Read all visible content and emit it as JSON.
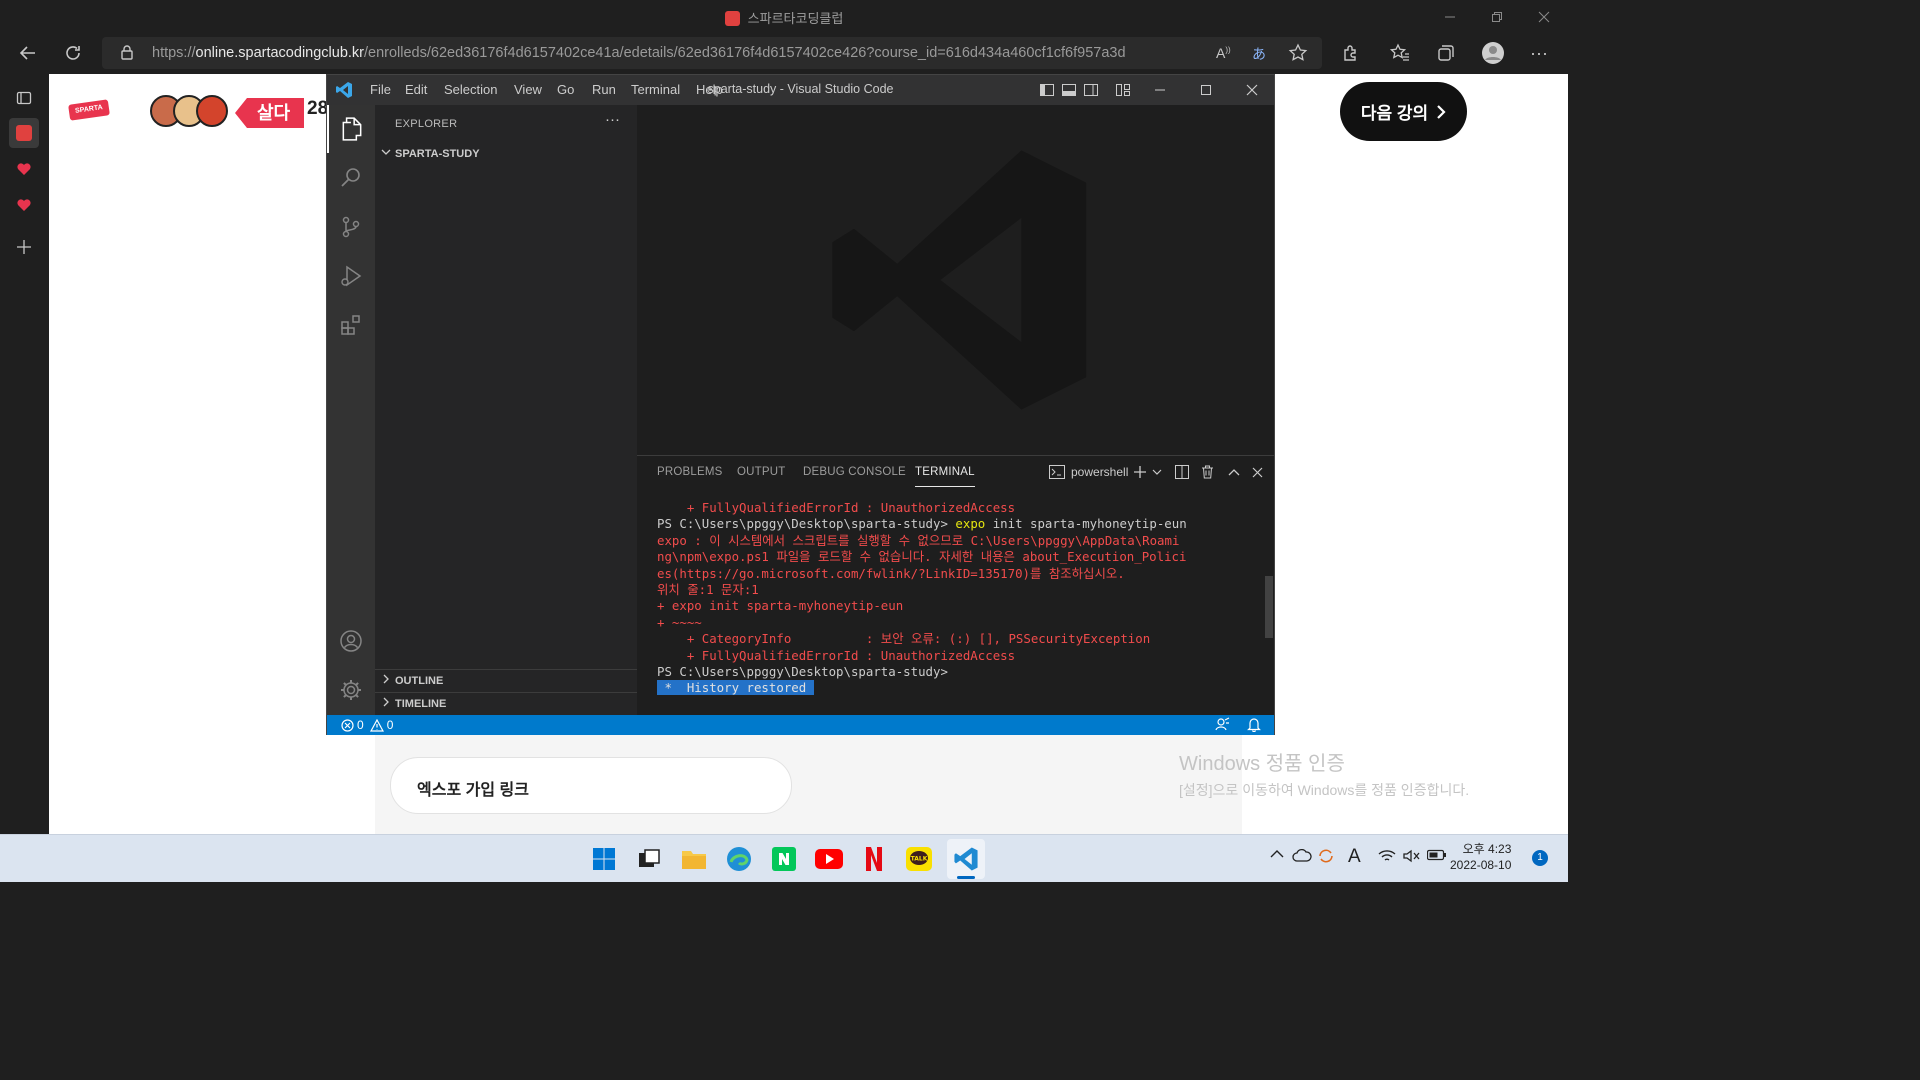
{
  "browser": {
    "tab_title": "스파르타코딩클럽",
    "url_prefix": "https://",
    "url_domain": "online.spartacodingclub.kr",
    "url_path": "/enrolleds/62ed36176f4d6157402ce41a/edetails/62ed36176f4d6157402ce426?course_id=616d434a460cf1cf6f957a3d"
  },
  "webpage": {
    "logo_text": "SPARTA",
    "live_badge": "살다",
    "live_count": "28",
    "next_lesson_label": "다음 강의",
    "expo_link_label": "엑스포 가입 링크",
    "windows_activate_title": "Windows 정품 인증",
    "windows_activate_desc": "[설정]으로 이동하여 Windows를 정품 인증합니다."
  },
  "vscode": {
    "menu": [
      "File",
      "Edit",
      "Selection",
      "View",
      "Go",
      "Run",
      "Terminal",
      "Help"
    ],
    "window_title": "sparta-study - Visual Studio Code",
    "explorer_header": "EXPLORER",
    "explorer_more": "···",
    "folder_name": "SPARTA-STUDY",
    "outline_label": "OUTLINE",
    "timeline_label": "TIMELINE",
    "panel_tabs": [
      "PROBLEMS",
      "OUTPUT",
      "DEBUG CONSOLE",
      "TERMINAL"
    ],
    "active_panel_tab": "TERMINAL",
    "shell_name": "powershell",
    "status_errors": "0",
    "status_warnings": "0",
    "terminal": {
      "l1": "    + FullyQualifiedErrorId : UnauthorizedAccess",
      "l2_prompt": "PS C:\\Users\\ppggy\\Desktop\\sparta-study> ",
      "l2_cmd": "expo",
      "l2_rest": " init sparta-myhoneytip-eun",
      "l3": "expo : 이 시스템에서 스크립트를 실행할 수 없으므로 C:\\Users\\ppggy\\AppData\\Roami",
      "l4": "ng\\npm\\expo.ps1 파일을 로드할 수 없습니다. 자세한 내용은 about_Execution_Polici",
      "l5": "es(https://go.microsoft.com/fwlink/?LinkID=135170)를 참조하십시오.",
      "l6": "위치 줄:1 문자:1",
      "l7": "+ expo init sparta-myhoneytip-eun",
      "l8": "+ ~~~~",
      "l9": "    + CategoryInfo          : 보안 오류: (:) [], PSSecurityException",
      "l10": "    + FullyQualifiedErrorId : UnauthorizedAccess",
      "l11": "PS C:\\Users\\ppggy\\Desktop\\sparta-study>",
      "l12": " *  History restored "
    }
  },
  "taskbar": {
    "time": "오후 4:23",
    "date": "2022-08-10",
    "notification_count": "1",
    "ime": "A"
  },
  "colors": {
    "vscode_blue": "#007acc",
    "terminal_red": "#f14c4c",
    "terminal_yellow": "#e5e510",
    "sparta_red": "#e8344e"
  }
}
